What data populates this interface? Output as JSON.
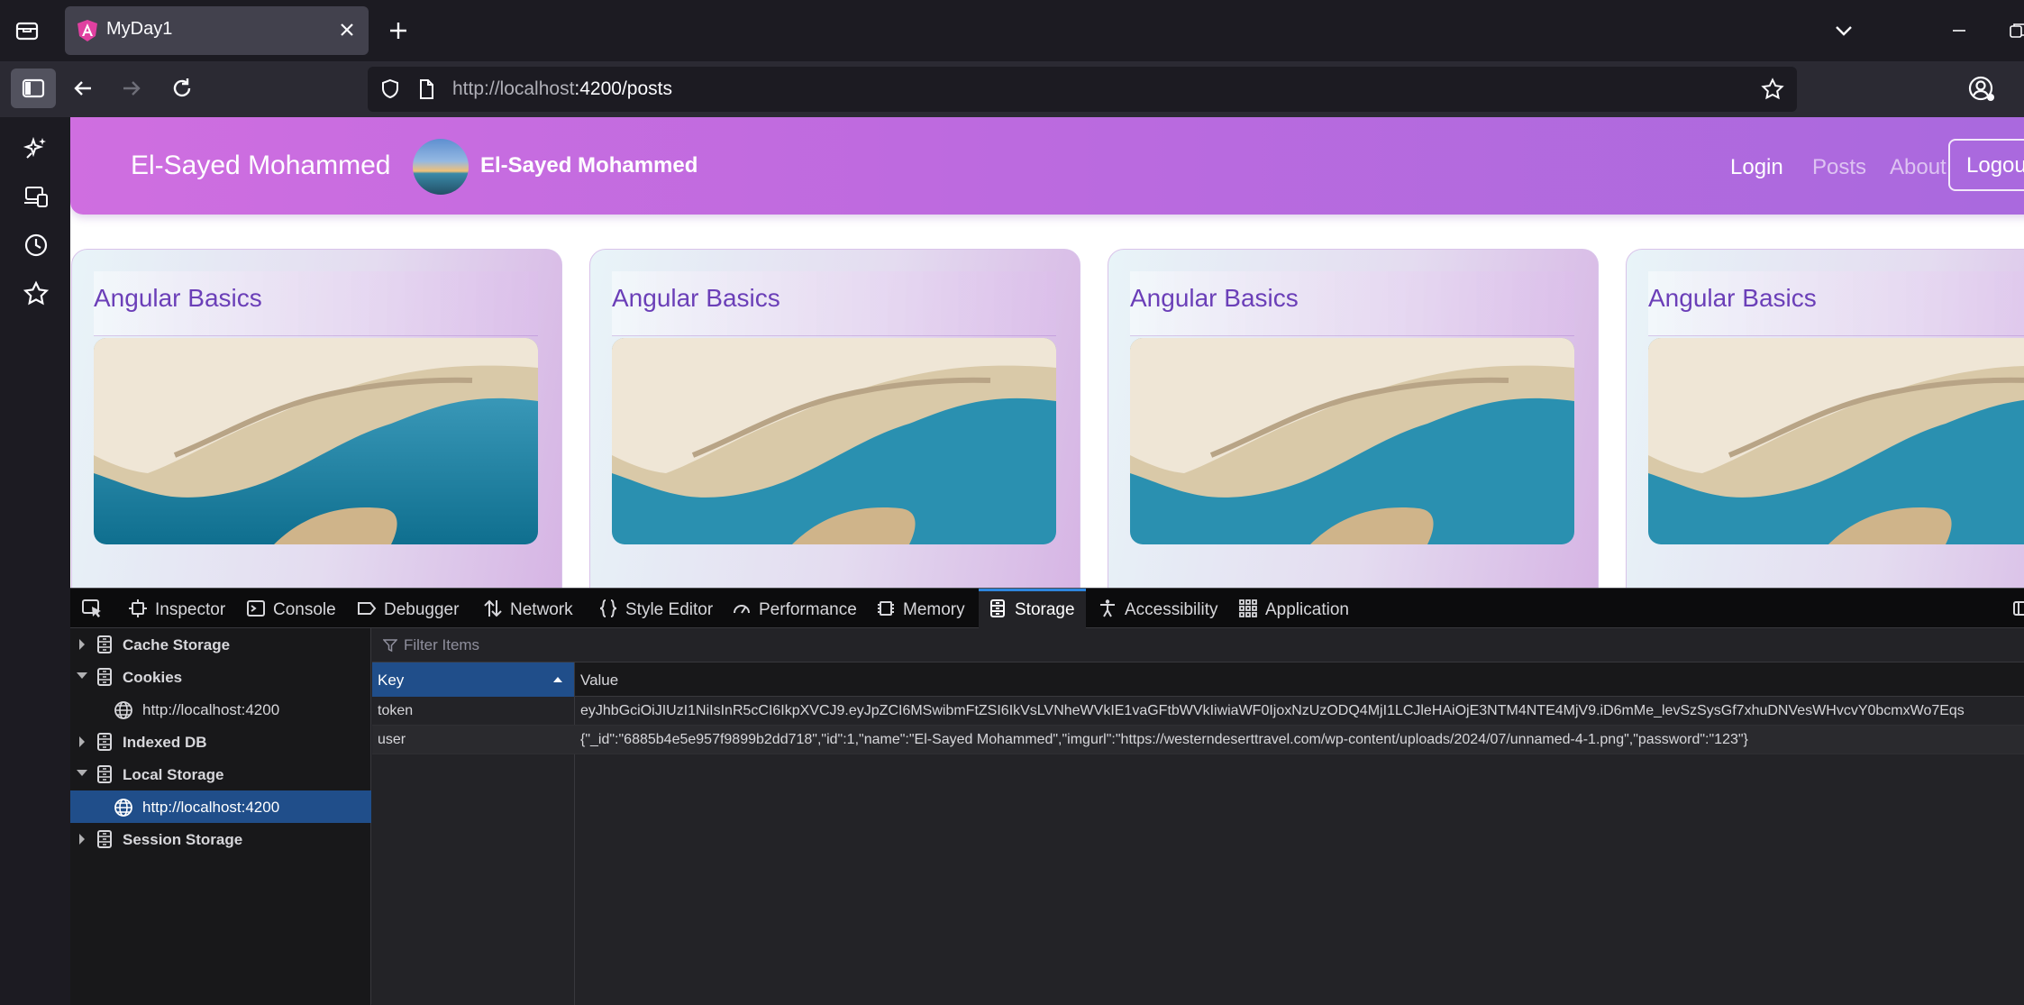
{
  "browser": {
    "tab_title": "MyDay1",
    "url_host": "http://localhost",
    "url_rest": ":4200/posts",
    "icons": [
      "tab-tray-icon",
      "close-icon",
      "plus-icon",
      "chevron-down-icon",
      "minimize-icon",
      "restore-icon",
      "sidebar-icon",
      "back-arrow-icon",
      "forward-arrow-icon",
      "reload-icon",
      "shield-icon",
      "page-icon",
      "star-icon",
      "account-icon",
      "ai-sparkle-icon",
      "synced-tabs-icon",
      "history-icon",
      "bookmarks-icon"
    ]
  },
  "app": {
    "brand": "El-Sayed Mohammed",
    "user_name": "El-Sayed Mohammed",
    "nav": {
      "login": "Login",
      "posts": "Posts",
      "about": "About",
      "logout": "Logout"
    },
    "accent": "#bd6adf",
    "posts": [
      {
        "title": "Angular Basics"
      },
      {
        "title": "Angular Basics"
      },
      {
        "title": "Angular Basics"
      },
      {
        "title": "Angular Basics"
      }
    ]
  },
  "devtools": {
    "tabs": {
      "inspector": "Inspector",
      "console": "Console",
      "debugger": "Debugger",
      "network": "Network",
      "style_editor": "Style Editor",
      "performance": "Performance",
      "memory": "Memory",
      "storage": "Storage",
      "accessibility": "Accessibility",
      "application": "Application"
    },
    "active_tab": "Storage",
    "tree": {
      "cache_storage": "Cache Storage",
      "cookies": "Cookies",
      "cookies_host": "http://localhost:4200",
      "indexed_db": "Indexed DB",
      "local_storage": "Local Storage",
      "local_host": "http://localhost:4200",
      "session_storage": "Session Storage"
    },
    "filter_placeholder": "Filter Items",
    "columns": {
      "key": "Key",
      "value": "Value"
    },
    "rows": [
      {
        "key": "token",
        "value": "eyJhbGciOiJIUzI1NiIsInR5cCI6IkpXVCJ9.eyJpZCI6MSwibmFtZSI6IkVsLVNheWVkIE1vaGFtbWVkIiwiaWF0IjoxNzUzODQ4MjI1LCJleHAiOjE3NTM4NTE4MjV9.iD6mMe_levSzSysGf7xhuDNVesWHvcvY0bcmxWo7Eqs"
      },
      {
        "key": "user",
        "value": "{\"_id\":\"6885b4e5e957f9899b2dd718\",\"id\":1,\"name\":\"El-Sayed Mohammed\",\"imgurl\":\"https://westerndeserttravel.com/wp-content/uploads/2024/07/unnamed-4-1.png\",\"password\":\"123\"}"
      }
    ]
  }
}
